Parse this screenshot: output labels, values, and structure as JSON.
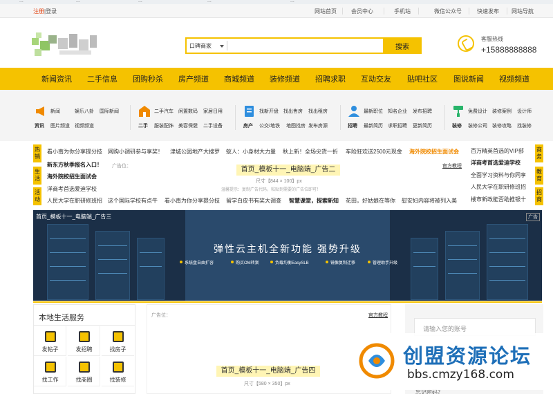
{
  "browser_bookmarks": [
    "...",
    "...",
    "...",
    "...",
    "..."
  ],
  "topbar": {
    "register": "注册",
    "sep": "|",
    "login": "登录",
    "links": [
      "网站首页",
      "会员中心",
      "手机站",
      "微信公众号",
      "快速发布",
      "网站导航"
    ]
  },
  "header": {
    "search_category": "口碑商家",
    "search_button": "搜索",
    "hotline_label": "客服热线",
    "hotline_number": "+15888888888"
  },
  "nav": [
    "新闻资讯",
    "二手信息",
    "团购秒杀",
    "房产频道",
    "商城频道",
    "装修频道",
    "招聘求职",
    "互动交友",
    "贴吧社区",
    "图说新闻",
    "视频频道"
  ],
  "categories": [
    {
      "main": "资讯",
      "links": [
        "新闻",
        "娱乐八卦",
        "国际新闻",
        "图片频道",
        "视频频道"
      ],
      "color": "#f08a00"
    },
    {
      "main": "二手",
      "links": [
        "二手汽车",
        "闲置数码",
        "家居日用",
        "服装配饰",
        "美容保健",
        "二手设备"
      ],
      "color": "#f08a00"
    },
    {
      "main": "房产",
      "links": [
        "找新开盘",
        "找出售房",
        "找出租房",
        "公交/地铁",
        "地图找房",
        "发布房源"
      ],
      "color": "#2e8ede"
    },
    {
      "main": "招聘",
      "links": [
        "最新职位",
        "知名企业",
        "发布招聘",
        "最新简历",
        "求职招聘",
        "更新简历"
      ],
      "color": "#2e8ede"
    },
    {
      "main": "装修",
      "links": [
        "免费设计",
        "装修案例",
        "设计师",
        "装修公司",
        "装修攻略",
        "找装修"
      ],
      "color": "#28b46a"
    }
  ],
  "hot": {
    "left_tabs": [
      "热销",
      "生活",
      "活动"
    ],
    "right_tabs": [
      "商务",
      "教育",
      "招商"
    ],
    "row1": [
      "看小南为你分享提分技",
      "网购小调研参与享奖！",
      "津城公园地产大搜罗",
      "蚁人：小身材大力量",
      "秋上新！全场尖货一折",
      "车险狂欢送2500元现金",
      "海外院校招生面试会"
    ],
    "left_col": [
      "新东方秋季报名入口！",
      "海外院校招生面试会",
      "洋商考首选爱迪学校",
      "人民大学在职研修班招"
    ],
    "right_col": [
      "百万精英首选的VIP部",
      "洋商考首选爱迪学校",
      "全面学习资料与你同享",
      "人民大学在职研修班招",
      "楼市新政能否助推银十"
    ],
    "row_bottom": [
      "这个国际学校有点牛",
      "看小南为你分享提分技",
      "留学白皮书有奖大调查",
      "智慧课堂，探索新知",
      "花田，好姑娘在等你",
      "慰安妇内容将被列入美"
    ],
    "ad_tag": "广告位：",
    "ad_link": "官方教程",
    "ad_name": "首页_模板十一_电脑端_广告二",
    "ad_size": "尺寸【844 × 100】px",
    "ad_hint": "温馨提示：复制广告代码，粘贴到需要的广告位即可！"
  },
  "banner": {
    "label": "首页_模板十一_电脑端_广告三",
    "tag": "广告",
    "title": "弹性云主机全新功能  强势升级",
    "features": [
      "系统盘自由扩容",
      "购买OM转案",
      "负载均衡EasySLB",
      "镜像复制迁移",
      "管理助手升级"
    ]
  },
  "life": {
    "title": "本地生活服务",
    "services": [
      "发帖子",
      "发招聘",
      "找房子",
      "找工作",
      "找商圈",
      "找装修"
    ]
  },
  "midad": {
    "tag": "广告位：",
    "link": "官方教程",
    "name": "首页_模板十一_电脑端_广告四",
    "size": "尺寸【580 × 350】px"
  },
  "login": {
    "account_placeholder": "请输入您的账号",
    "forgot": "忘记密码？"
  },
  "watermark": {
    "title": "创盟资源论坛",
    "url": "bbs.cmzy168.com"
  }
}
